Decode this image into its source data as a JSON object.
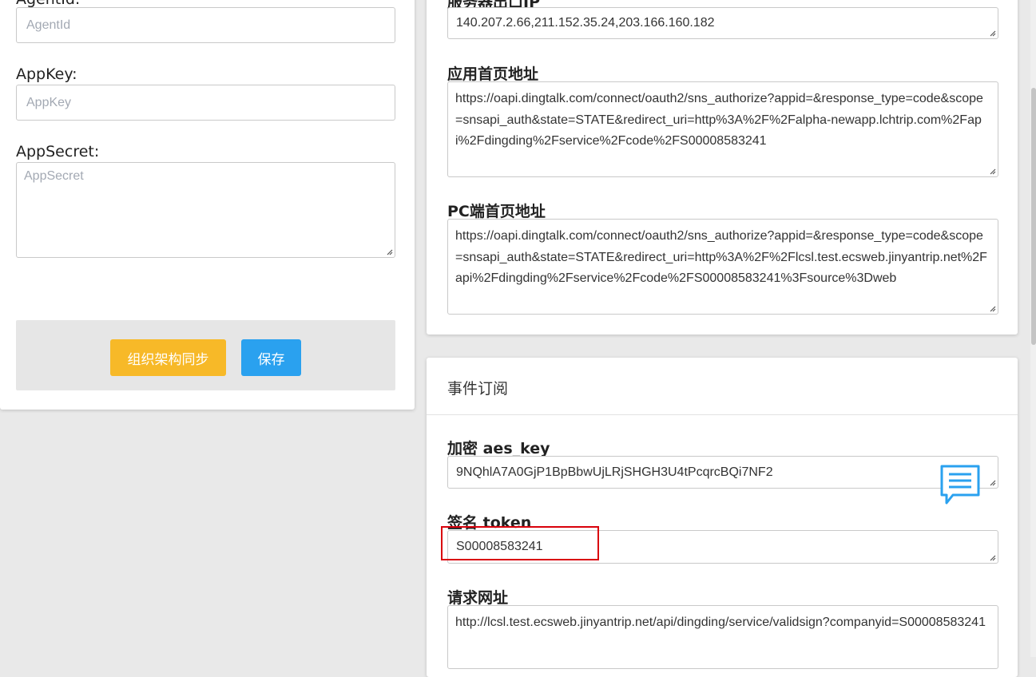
{
  "left_panel": {
    "agentid_label": "AgentId:",
    "agentid_placeholder": "AgentId",
    "appkey_label": "AppKey:",
    "appkey_placeholder": "AppKey",
    "appsecret_label": "AppSecret:",
    "appsecret_placeholder": "AppSecret",
    "sync_button": "组织架构同步",
    "save_button": "保存"
  },
  "right_top": {
    "server_ip_label": "服务器出口IP",
    "server_ip_value": "140.207.2.66,211.152.35.24,203.166.160.182",
    "app_home_label": "应用首页地址",
    "app_home_value": "https://oapi.dingtalk.com/connect/oauth2/sns_authorize?appid=&response_type=code&scope=snsapi_auth&state=STATE&redirect_uri=http%3A%2F%2Falpha-newapp.lchtrip.com%2Fapi%2Fdingding%2Fservice%2Fcode%2FS00008583241",
    "pc_home_label": "PC端首页地址",
    "pc_home_value": "https://oapi.dingtalk.com/connect/oauth2/sns_authorize?appid=&response_type=code&scope=snsapi_auth&state=STATE&redirect_uri=http%3A%2F%2Flcsl.test.ecsweb.jinyantrip.net%2Fapi%2Fdingding%2Fservice%2Fcode%2FS00008583241%3Fsource%3Dweb"
  },
  "event_subscription": {
    "title": "事件订阅",
    "aes_key_label": "加密 aes_key",
    "aes_key_value": "9NQhlA7A0GjP1BpBbwUjLRjSHGH3U4tPcqrcBQi7NF2",
    "token_label": "签名 token",
    "token_value": "S00008583241",
    "request_url_label": "请求网址",
    "request_url_value": "http://lcsl.test.ecsweb.jinyantrip.net/api/dingding/service/validsign?companyid=S00008583241"
  },
  "colors": {
    "sync_button_bg": "#f7b928",
    "save_button_bg": "#2aa1ef",
    "highlight_border": "#d9000b",
    "chat_icon": "#2aa1ef"
  },
  "icons": {
    "chat": "chat-bubble-icon",
    "resize": "resize-grip-icon"
  }
}
